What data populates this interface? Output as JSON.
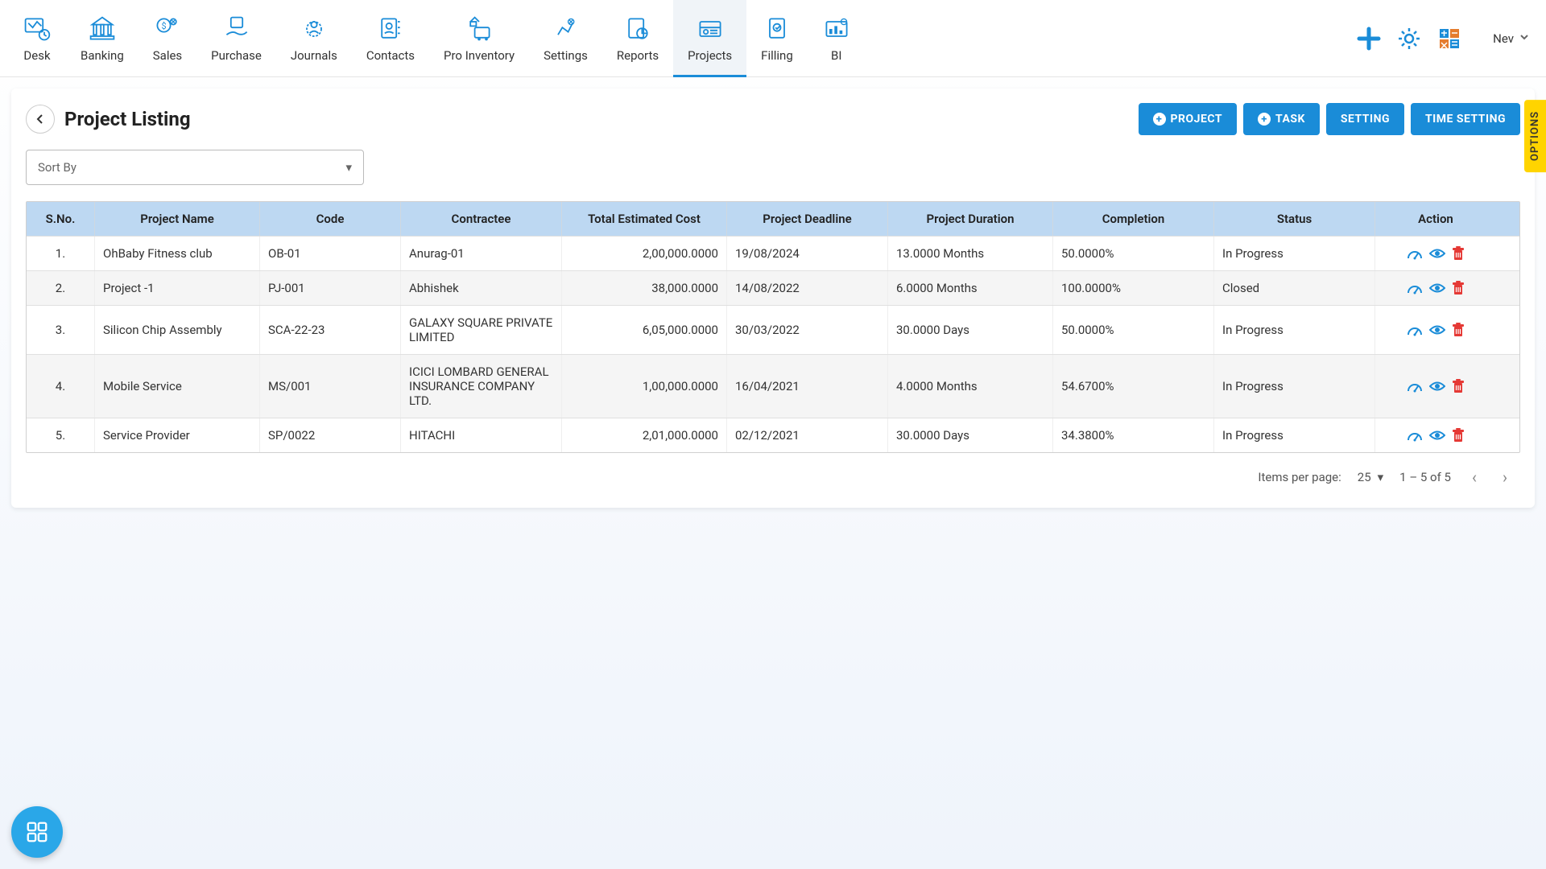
{
  "nav": {
    "items": [
      {
        "label": "Desk"
      },
      {
        "label": "Banking"
      },
      {
        "label": "Sales"
      },
      {
        "label": "Purchase"
      },
      {
        "label": "Journals"
      },
      {
        "label": "Contacts"
      },
      {
        "label": "Pro Inventory"
      },
      {
        "label": "Settings"
      },
      {
        "label": "Reports"
      },
      {
        "label": "Projects"
      },
      {
        "label": "Filling"
      },
      {
        "label": "BI"
      }
    ]
  },
  "user": {
    "label": "Nev"
  },
  "page": {
    "title": "Project Listing"
  },
  "buttons": {
    "project": "PROJECT",
    "task": "TASK",
    "setting": "SETTING",
    "time_setting": "TIME SETTING"
  },
  "sort": {
    "label": "Sort By"
  },
  "options_tab": "OPTIONS",
  "table": {
    "headers": [
      "S.No.",
      "Project Name",
      "Code",
      "Contractee",
      "Total Estimated Cost",
      "Project Deadline",
      "Project Duration",
      "Completion",
      "Status",
      "Action"
    ],
    "rows": [
      {
        "sno": "1.",
        "name": "OhBaby Fitness club",
        "code": "OB-01",
        "contractee": "Anurag-01",
        "cost": "2,00,000.0000",
        "deadline": "19/08/2024",
        "duration": "13.0000 Months",
        "completion": "50.0000%",
        "status": "In Progress"
      },
      {
        "sno": "2.",
        "name": "Project -1",
        "code": "PJ-001",
        "contractee": "Abhishek",
        "cost": "38,000.0000",
        "deadline": "14/08/2022",
        "duration": "6.0000 Months",
        "completion": "100.0000%",
        "status": "Closed"
      },
      {
        "sno": "3.",
        "name": "Silicon Chip Assembly",
        "code": "SCA-22-23",
        "contractee": "GALAXY SQUARE PRIVATE LIMITED",
        "cost": "6,05,000.0000",
        "deadline": "30/03/2022",
        "duration": "30.0000 Days",
        "completion": "50.0000%",
        "status": "In Progress"
      },
      {
        "sno": "4.",
        "name": "Mobile Service",
        "code": "MS/001",
        "contractee": "ICICI LOMBARD GENERAL INSURANCE COMPANY LTD.",
        "cost": "1,00,000.0000",
        "deadline": "16/04/2021",
        "duration": "4.0000 Months",
        "completion": "54.6700%",
        "status": "In Progress"
      },
      {
        "sno": "5.",
        "name": "Service Provider",
        "code": "SP/0022",
        "contractee": "HITACHI",
        "cost": "2,01,000.0000",
        "deadline": "02/12/2021",
        "duration": "30.0000 Days",
        "completion": "34.3800%",
        "status": "In Progress"
      }
    ]
  },
  "pagination": {
    "items_label": "Items per page:",
    "per_page": "25",
    "range": "1 – 5 of 5"
  },
  "colors": {
    "primary": "#1a8cd8",
    "accent": "#ffd400",
    "icon_blue": "#1a8cd8",
    "danger": "#e53935"
  }
}
